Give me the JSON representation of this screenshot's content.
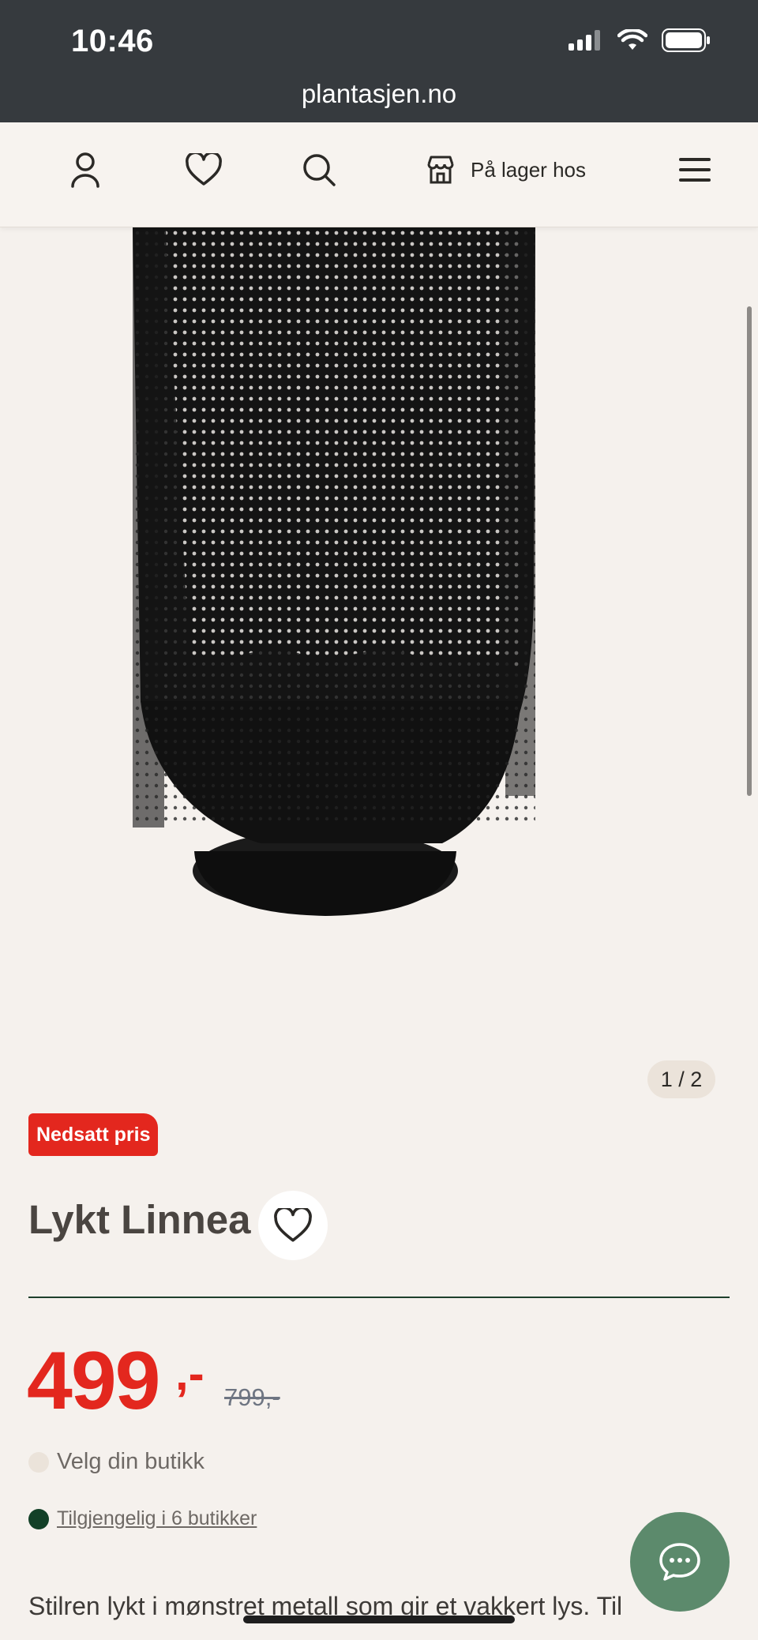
{
  "status_bar": {
    "time": "10:46"
  },
  "browser": {
    "url": "plantasjen.no"
  },
  "header": {
    "account_icon": "person-icon",
    "wishlist_icon": "heart-icon",
    "search_icon": "search-icon",
    "store_icon": "store-icon",
    "store_label": "På lager hos",
    "menu_icon": "hamburger-icon"
  },
  "gallery": {
    "pager": "1 / 2"
  },
  "product": {
    "badge": "Nedsatt pris",
    "title": "Lykt Linnea",
    "price_now": "499",
    "price_suffix": ",-",
    "price_old": "799,-",
    "store_select": "Velg din butikk",
    "availability": "Tilgjengelig i 6 butikker",
    "description": "Stilren lykt i mønstret metall som gir et vakkert lys. Til"
  },
  "colors": {
    "accent_red": "#e3271e",
    "brand_green": "#124027",
    "chat_green": "#5c8a6c",
    "background": "#f5f1ed"
  }
}
